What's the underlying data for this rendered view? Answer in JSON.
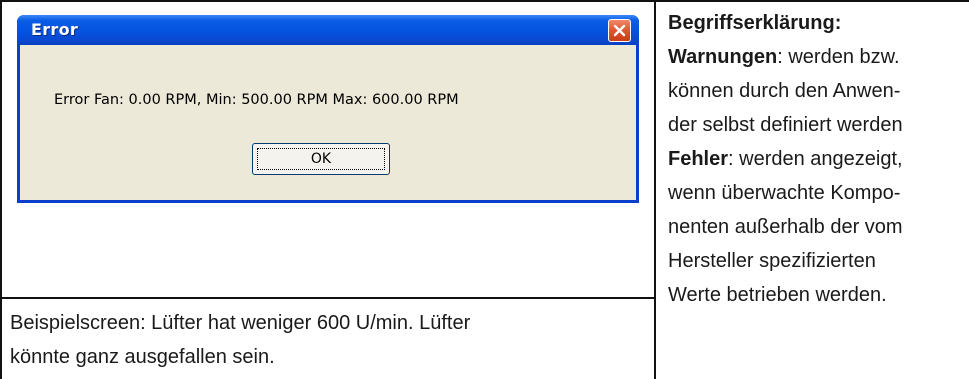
{
  "dialog": {
    "title": "Error",
    "message": "Error Fan: 0.00 RPM, Min: 500.00 RPM Max: 600.00 RPM",
    "ok_label": "OK",
    "close_icon": "close-icon"
  },
  "caption": {
    "line1": "Beispielscreen: Lüfter hat weniger 600 U/min. Lüfter",
    "line2": "könnte ganz ausgefallen sein."
  },
  "glossary": {
    "heading": "Begriffserklärung:",
    "term1": "Warnungen",
    "term1_desc_1": ": werden bzw.",
    "term1_desc_2": "können durch den Anwen-",
    "term1_desc_3": "der selbst definiert werden",
    "term2": "Fehler",
    "term2_desc_1": ": werden angezeigt,",
    "term2_desc_2": "wenn überwachte Kompo-",
    "term2_desc_3": "nenten außerhalb der vom",
    "term2_desc_4": "Hersteller spezifizierten",
    "term2_desc_5": "Werte betrieben werden."
  },
  "colors": {
    "titlebar": "#0553e0",
    "dialog_bg": "#ece9d8",
    "close_button": "#e0552f"
  }
}
